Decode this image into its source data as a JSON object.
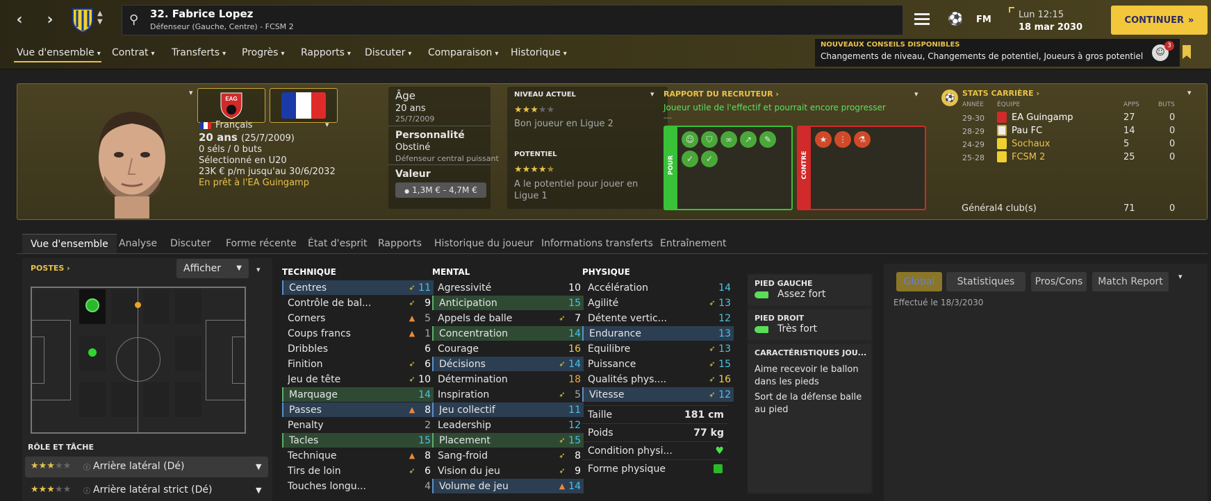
{
  "header": {
    "player_title": "32. Fabrice Lopez",
    "player_sub": "Défenseur (Gauche, Centre) - FCSM 2",
    "fm_label": "FM",
    "time": "Lun 12:15",
    "date": "18 mar 2030",
    "continue_label": "CONTINUER",
    "conseils_title": "NOUVEAUX CONSEILS DISPONIBLES",
    "conseils_text": "Changements de niveau, Changements de potentiel, Joueurs à gros potentiel",
    "notif_count": "3"
  },
  "menu": [
    {
      "label": "Vue d'ensemble"
    },
    {
      "label": "Contrat"
    },
    {
      "label": "Transferts"
    },
    {
      "label": "Progrès"
    },
    {
      "label": "Rapports"
    },
    {
      "label": "Discuter"
    },
    {
      "label": "Comparaison"
    },
    {
      "label": "Historique"
    }
  ],
  "profile": {
    "nationality": "Français",
    "age_line": "20 ans",
    "birth_paren": "(25/7/2009)",
    "caps": "0 séls / 0 buts",
    "selection": "Sélectionné en U20",
    "contract": "23K € p/m jusqu'au 30/6/2032",
    "loan": "En prêt à l'EA Guingamp",
    "age_label": "Âge",
    "age_value": "20 ans",
    "birth": "25/7/2009",
    "personality_label": "Personnalité",
    "personality_value": "Obstiné",
    "personality_sub": "Défenseur central puissant",
    "value_label": "Valeur",
    "value_value": "1,3M € - 4,7M €",
    "current_label": "NIVEAU ACTUEL",
    "current_stars": 3,
    "current_desc": "Bon joueur en Ligue 2",
    "potential_label": "POTENTIEL",
    "potential_stars": 4.5,
    "potential_desc": "A le potentiel pour jouer en Ligue 1",
    "scout_title": "RAPPORT DU RECRUTEUR",
    "scout_text": "Joueur utile de l'effectif et pourrait encore progresser",
    "scout_dash": "---",
    "pour_label": "POUR",
    "contre_label": "CONTRE",
    "club_badge": "EAG"
  },
  "career": {
    "title": "STATS CARRIÈRE",
    "col_year": "ANNÉE",
    "col_team": "ÉQUIPE",
    "col_apps": "APPS",
    "col_goals": "BUTS",
    "rows": [
      {
        "year": "29-30",
        "team": "EA Guingamp",
        "apps": "27",
        "goals": "0"
      },
      {
        "year": "28-29",
        "team": "Pau FC",
        "apps": "14",
        "goals": "0"
      },
      {
        "year": "24-29",
        "team": "Sochaux",
        "apps": "5",
        "goals": "0"
      },
      {
        "year": "25-28",
        "team": "FCSM 2",
        "apps": "25",
        "goals": "0"
      }
    ],
    "total_label": "Général",
    "total_clubs": "4 club(s)",
    "total_apps": "71",
    "total_goals": "0"
  },
  "tabs": [
    {
      "label": "Vue d'ensemble"
    },
    {
      "label": "Analyse"
    },
    {
      "label": "Discuter"
    },
    {
      "label": "Forme récente"
    },
    {
      "label": "État d'esprit"
    },
    {
      "label": "Rapports"
    },
    {
      "label": "Historique du joueur"
    },
    {
      "label": "Informations transferts"
    },
    {
      "label": "Entraînement"
    }
  ],
  "positions": {
    "title": "POSTES",
    "show_label": "Afficher"
  },
  "role": {
    "title": "RÔLE ET TÂCHE",
    "items": [
      {
        "label": "Arrière latéral (Dé)",
        "stars": 3
      },
      {
        "label": "Arrière latéral strict (Dé)",
        "stars": 3
      }
    ]
  },
  "technique": {
    "title": "TECHNIQUE",
    "rows": [
      {
        "name": "Centres",
        "value": "11",
        "arrow": "up",
        "hl": "blue",
        "color": "cyan"
      },
      {
        "name": "Contrôle de bal...",
        "value": "9",
        "arrow": "up",
        "hl": "",
        "color": "white"
      },
      {
        "name": "Corners",
        "value": "5",
        "arrow": "down",
        "hl": "",
        "color": "gray"
      },
      {
        "name": "Coups francs",
        "value": "1",
        "arrow": "down",
        "hl": "",
        "color": "gray"
      },
      {
        "name": "Dribbles",
        "value": "6",
        "arrow": "",
        "hl": "",
        "color": "white"
      },
      {
        "name": "Finition",
        "value": "6",
        "arrow": "up",
        "hl": "",
        "color": "white"
      },
      {
        "name": "Jeu de tête",
        "value": "10",
        "arrow": "up",
        "hl": "",
        "color": "white"
      },
      {
        "name": "Marquage",
        "value": "14",
        "arrow": "",
        "hl": "green",
        "color": "cyan"
      },
      {
        "name": "Passes",
        "value": "8",
        "arrow": "down",
        "hl": "blue",
        "color": "white"
      },
      {
        "name": "Penalty",
        "value": "2",
        "arrow": "",
        "hl": "",
        "color": "gray"
      },
      {
        "name": "Tacles",
        "value": "15",
        "arrow": "",
        "hl": "green",
        "color": "cyan"
      },
      {
        "name": "Technique",
        "value": "8",
        "arrow": "down",
        "hl": "",
        "color": "white"
      },
      {
        "name": "Tirs de loin",
        "value": "6",
        "arrow": "up",
        "hl": "",
        "color": "white"
      },
      {
        "name": "Touches longu...",
        "value": "4",
        "arrow": "",
        "hl": "",
        "color": "gray"
      }
    ]
  },
  "mental": {
    "title": "MENTAL",
    "rows": [
      {
        "name": "Agressivité",
        "value": "10",
        "arrow": "",
        "hl": "",
        "color": "white"
      },
      {
        "name": "Anticipation",
        "value": "15",
        "arrow": "",
        "hl": "green",
        "color": "cyan"
      },
      {
        "name": "Appels de balle",
        "value": "7",
        "arrow": "up",
        "hl": "",
        "color": "white"
      },
      {
        "name": "Concentration",
        "value": "14",
        "arrow": "",
        "hl": "green",
        "color": "cyan"
      },
      {
        "name": "Courage",
        "value": "16",
        "arrow": "",
        "hl": "",
        "color": "yellow"
      },
      {
        "name": "Décisions",
        "value": "14",
        "arrow": "up",
        "hl": "blue",
        "color": "cyan"
      },
      {
        "name": "Détermination",
        "value": "18",
        "arrow": "",
        "hl": "",
        "color": "orange"
      },
      {
        "name": "Inspiration",
        "value": "5",
        "arrow": "up",
        "hl": "",
        "color": "gray"
      },
      {
        "name": "Jeu collectif",
        "value": "11",
        "arrow": "",
        "hl": "blue",
        "color": "cyan"
      },
      {
        "name": "Leadership",
        "value": "12",
        "arrow": "",
        "hl": "",
        "color": "cyan"
      },
      {
        "name": "Placement",
        "value": "15",
        "arrow": "up",
        "hl": "green",
        "color": "cyan"
      },
      {
        "name": "Sang-froid",
        "value": "8",
        "arrow": "up",
        "hl": "",
        "color": "white"
      },
      {
        "name": "Vision du jeu",
        "value": "9",
        "arrow": "up",
        "hl": "",
        "color": "white"
      },
      {
        "name": "Volume de jeu",
        "value": "14",
        "arrow": "down",
        "hl": "blue",
        "color": "cyan"
      }
    ]
  },
  "physique": {
    "title": "PHYSIQUE",
    "rows": [
      {
        "name": "Accélération",
        "value": "14",
        "arrow": "",
        "hl": "",
        "color": "cyan"
      },
      {
        "name": "Agilité",
        "value": "13",
        "arrow": "up",
        "hl": "",
        "color": "cyan"
      },
      {
        "name": "Détente vertic...",
        "value": "12",
        "arrow": "",
        "hl": "",
        "color": "cyan"
      },
      {
        "name": "Endurance",
        "value": "13",
        "arrow": "",
        "hl": "blue",
        "color": "cyan"
      },
      {
        "name": "Équilibre",
        "value": "13",
        "arrow": "up",
        "hl": "",
        "color": "cyan"
      },
      {
        "name": "Puissance",
        "value": "15",
        "arrow": "up",
        "hl": "",
        "color": "cyan"
      },
      {
        "name": "Qualités phys....",
        "value": "16",
        "arrow": "up",
        "hl": "",
        "color": "yellow"
      },
      {
        "name": "Vitesse",
        "value": "12",
        "arrow": "up",
        "hl": "blue",
        "color": "cyan"
      }
    ],
    "height_label": "Taille",
    "height_value": "181 cm",
    "weight_label": "Poids",
    "weight_value": "77 kg",
    "condition_label": "Condition physi...",
    "form_label": "Forme physique"
  },
  "feet": {
    "left_title": "PIED GAUCHE",
    "left_value": "Assez fort",
    "right_title": "PIED DROIT",
    "right_value": "Très fort",
    "traits_title": "CARACTÉRISTIQUES JOU...",
    "traits": [
      "Aime recevoir le ballon dans les pieds",
      "Sort de la défense balle au pied"
    ]
  },
  "report": {
    "tabs": [
      "Global",
      "Statistiques",
      "Pros/Cons",
      "Match Report"
    ],
    "done": "Effectué le 18/3/2030"
  }
}
